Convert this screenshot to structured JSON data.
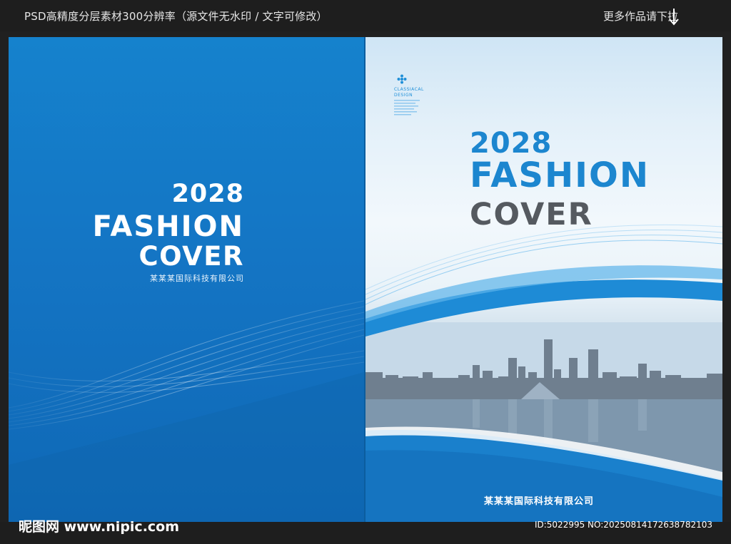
{
  "header": {
    "left_text": "PSD高精度分层素材300分辨率（源文件无水印 / 文字可修改）",
    "right_text": "更多作品请下拉"
  },
  "back_cover": {
    "year": "2028",
    "title_line1": "FASHION",
    "title_line2": "COVER",
    "company": "某某某国际科技有限公司"
  },
  "front_cover": {
    "logo_line1": "CLASSIACAL",
    "logo_line2": "DESIGN",
    "year": "2028",
    "title_line1": "FASHION",
    "title_line2": "COVER",
    "company": "某某某国际科技有限公司"
  },
  "footer": {
    "site": "昵图网 www.nipic.com",
    "id_text": "ID:5022995 NO:20250814172638782103"
  },
  "colors": {
    "accent_blue": "#1c86cf",
    "dark_gray": "#555a60",
    "background": "#1e1e1e"
  }
}
